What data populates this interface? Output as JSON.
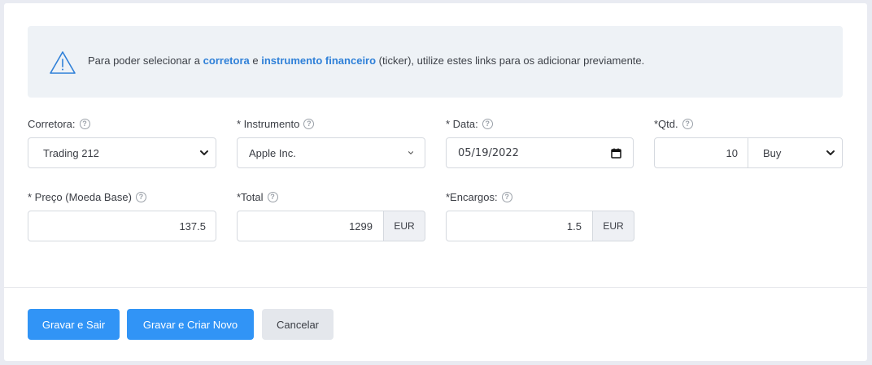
{
  "alert": {
    "icon": "warning-triangle-icon",
    "text_before": "Para poder selecionar a ",
    "link_broker": "corretora",
    "text_mid": " e ",
    "link_instrument": "instrumento financeiro",
    "text_after": " (ticker), utilize estes links para os adicionar previamente."
  },
  "fields": {
    "broker": {
      "label": "Corretora:",
      "value": "Trading 212"
    },
    "instrument": {
      "label": "* Instrumento",
      "value": "Apple Inc."
    },
    "date": {
      "label": "* Data:",
      "value": "05/19/2022"
    },
    "quantity": {
      "label": "*Qtd.",
      "value": "10",
      "side": "Buy"
    },
    "price": {
      "label": "* Preço (Moeda Base)",
      "value": "137.5"
    },
    "total": {
      "label": "*Total",
      "value": "1299",
      "currency": "EUR"
    },
    "fees": {
      "label": "*Encargos:",
      "value": "1.5",
      "currency": "EUR"
    }
  },
  "buttons": {
    "save_exit": "Gravar e Sair",
    "save_new": "Gravar e Criar Novo",
    "cancel": "Cancelar"
  },
  "colors": {
    "primary": "#3194f6",
    "link": "#2f80d8",
    "alert_bg": "#eef2f6"
  }
}
